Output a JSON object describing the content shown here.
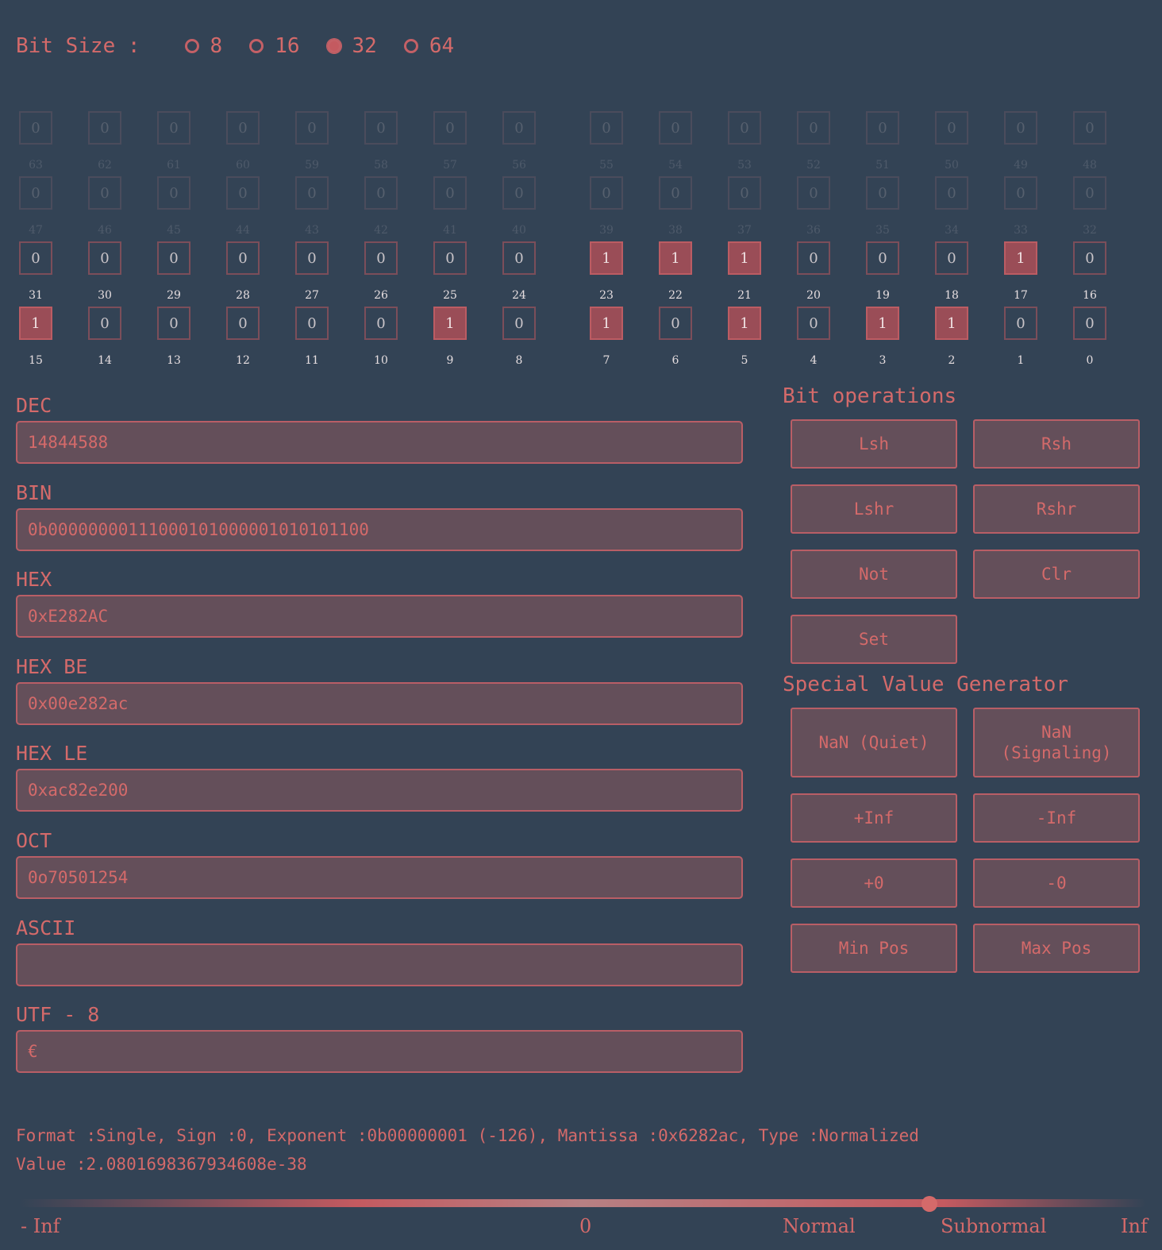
{
  "bit_size": {
    "label": "Bit Size :",
    "options": [
      "8",
      "16",
      "32",
      "64"
    ],
    "selected": "32"
  },
  "bit_rows": [
    {
      "bits": [
        0,
        0,
        0,
        0,
        0,
        0,
        0,
        0,
        0,
        0,
        0,
        0,
        0,
        0,
        0,
        0
      ],
      "indices": [
        "63",
        "62",
        "61",
        "60",
        "59",
        "58",
        "57",
        "56",
        "55",
        "54",
        "53",
        "52",
        "51",
        "50",
        "49",
        "48"
      ],
      "active": false
    },
    {
      "bits": [
        0,
        0,
        0,
        0,
        0,
        0,
        0,
        0,
        0,
        0,
        0,
        0,
        0,
        0,
        0,
        0
      ],
      "indices": [
        "47",
        "46",
        "45",
        "44",
        "43",
        "42",
        "41",
        "40",
        "39",
        "38",
        "37",
        "36",
        "35",
        "34",
        "33",
        "32"
      ],
      "active": false
    },
    {
      "bits": [
        0,
        0,
        0,
        0,
        0,
        0,
        0,
        0,
        1,
        1,
        1,
        0,
        0,
        0,
        1,
        0
      ],
      "indices": [
        "31",
        "30",
        "29",
        "28",
        "27",
        "26",
        "25",
        "24",
        "23",
        "22",
        "21",
        "20",
        "19",
        "18",
        "17",
        "16"
      ],
      "active": true
    },
    {
      "bits": [
        1,
        0,
        0,
        0,
        0,
        0,
        1,
        0,
        1,
        0,
        1,
        0,
        1,
        1,
        0,
        0
      ],
      "indices": [
        "15",
        "14",
        "13",
        "12",
        "11",
        "10",
        "9",
        "8",
        "7",
        "6",
        "5",
        "4",
        "3",
        "2",
        "1",
        "0"
      ],
      "active": true
    }
  ],
  "fields": [
    {
      "label": "DEC",
      "value": "14844588"
    },
    {
      "label": "BIN",
      "value": "0b00000000111000101000001010101100"
    },
    {
      "label": "HEX",
      "value": "0xE282AC"
    },
    {
      "label": "HEX BE",
      "value": "0x00e282ac"
    },
    {
      "label": "HEX LE",
      "value": "0xac82e200"
    },
    {
      "label": "OCT",
      "value": "0o70501254"
    },
    {
      "label": "ASCII",
      "value": ""
    },
    {
      "label": "UTF - 8",
      "value": "€"
    }
  ],
  "bit_operations": {
    "title": "Bit operations",
    "buttons": [
      "Lsh",
      "Rsh",
      "Lshr",
      "Rshr",
      "Not",
      "Clr",
      "Set"
    ]
  },
  "special_values": {
    "title": "Special Value Generator",
    "buttons": [
      "NaN (Quiet)",
      "NaN (Signaling)",
      "+Inf",
      "-Inf",
      "+0",
      "-0",
      "Min Pos",
      "Max Pos"
    ]
  },
  "float_info": {
    "line1": "Format :Single, Sign :0, Exponent :0b00000001 (-126), Mantissa :0x6282ac, Type :Normalized",
    "line2": "Value :2.0801698367934608e-38"
  },
  "scale": {
    "labels": [
      "- Inf",
      "0",
      "Normal",
      "Subnormal",
      "Inf"
    ],
    "marker_fraction": 0.8
  },
  "colors": {
    "background": "#334355",
    "accent": "#d46a6a",
    "field_fill": "#644f5a",
    "bit_on": "#9a4d57"
  }
}
